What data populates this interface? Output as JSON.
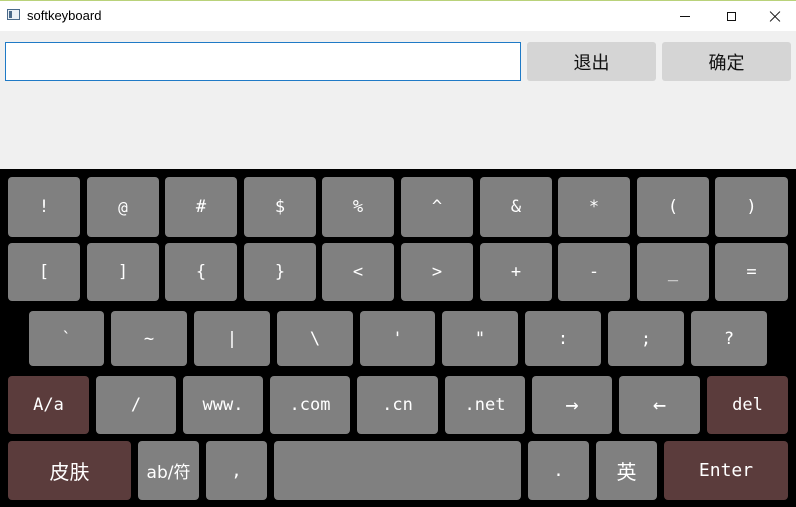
{
  "window": {
    "title": "softkeyboard"
  },
  "input": {
    "value": "",
    "placeholder": ""
  },
  "buttons": {
    "exit": "退出",
    "confirm": "确定"
  },
  "keyboard": {
    "row1": [
      "!",
      "@",
      "#",
      "$",
      "%",
      "^",
      "&",
      "*",
      "(",
      ")"
    ],
    "row2": [
      "[",
      "]",
      "{",
      "}",
      "<",
      ">",
      "+",
      "-",
      "_",
      "="
    ],
    "row3": [
      "`",
      "~",
      "|",
      "\\",
      "'",
      "\"",
      ":",
      ";",
      "?"
    ],
    "row4": [
      "A/a",
      "/",
      "www.",
      ".com",
      ".cn",
      ".net",
      "→",
      "←",
      "del"
    ],
    "row5": [
      "皮肤",
      "ab/符",
      ",",
      "",
      ".",
      "英",
      "Enter"
    ]
  },
  "colors": {
    "key": "#808080",
    "special_key": "#5b3c3c",
    "keyboard_bg": "#000000",
    "panel_bg": "#f0f0f0",
    "input_border": "#1f7ac6"
  }
}
